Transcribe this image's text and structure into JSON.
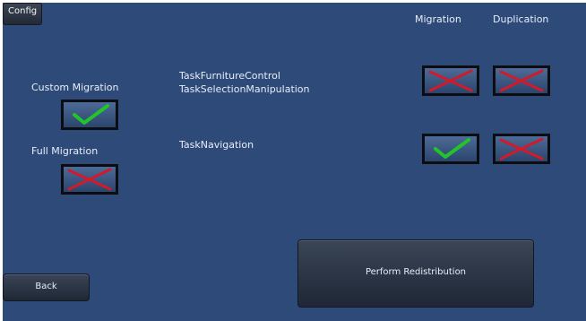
{
  "config_button": "Config",
  "columns": {
    "migration": "Migration",
    "duplication": "Duplication"
  },
  "options": {
    "custom_migration": {
      "label": "Custom Migration",
      "checked": true
    },
    "full_migration": {
      "label": "Full Migration",
      "checked": false
    }
  },
  "tasks": [
    {
      "label_lines": [
        "TaskFurnitureControl",
        "TaskSelectionManipulation"
      ],
      "migration": false,
      "duplication": false
    },
    {
      "label_lines": [
        "TaskNavigation"
      ],
      "migration": true,
      "duplication": false
    }
  ],
  "buttons": {
    "back": "Back",
    "perform": "Perform Redistribution"
  },
  "colors": {
    "background": "#2d4a78",
    "check": "#22c42a",
    "cross": "#d11a2a"
  }
}
